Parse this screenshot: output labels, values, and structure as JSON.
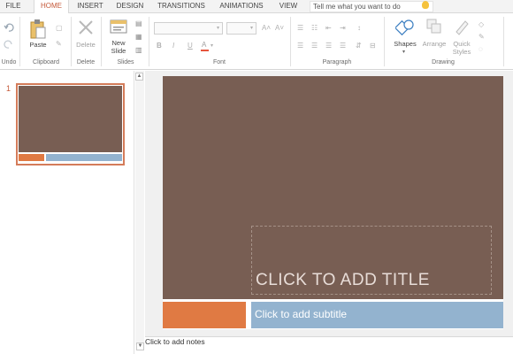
{
  "tabs": [
    "FILE",
    "HOME",
    "INSERT",
    "DESIGN",
    "TRANSITIONS",
    "ANIMATIONS",
    "VIEW"
  ],
  "active_tab": "HOME",
  "tell_me_placeholder": "Tell me what you want to do",
  "ribbon": {
    "groups": {
      "undo": "Undo",
      "clipboard": "Clipboard",
      "delete": "Delete",
      "slides": "Slides",
      "font": "Font",
      "paragraph": "Paragraph",
      "drawing": "Drawing"
    },
    "paste_label": "Paste",
    "delete_label": "Delete",
    "new_slide_label": "New Slide",
    "shapes_label": "Shapes",
    "arrange_label": "Arrange",
    "quick_styles_label": "Quick Styles",
    "bold": "B",
    "italic": "I",
    "underline": "U"
  },
  "slide_number": "1",
  "slide": {
    "title_placeholder": "CLICK TO ADD TITLE",
    "subtitle_placeholder": "Click to add subtitle"
  },
  "notes_placeholder": "Click to add notes",
  "colors": {
    "slide_background": "#785e53",
    "accent_orange": "#e07a43",
    "accent_blue": "#93b3cf",
    "active_tab_text": "#c55a3a"
  }
}
